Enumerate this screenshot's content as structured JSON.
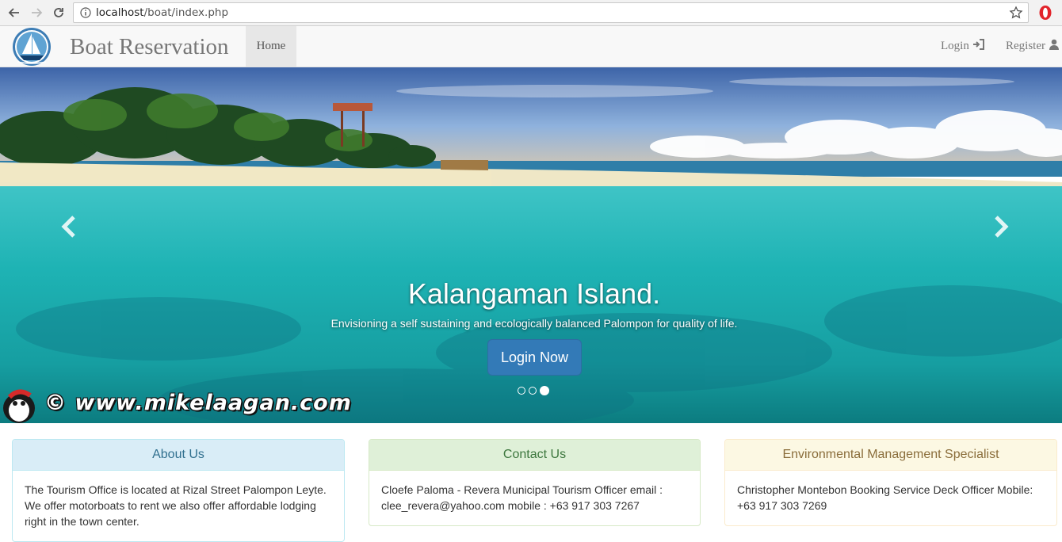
{
  "browser": {
    "url_host": "localhost",
    "url_path": "/boat/index.php"
  },
  "navbar": {
    "brand": "Boat Reservation",
    "home": "Home",
    "login": "Login",
    "register": "Register"
  },
  "carousel": {
    "title": "Kalangaman Island.",
    "subtitle": "Envisioning a self sustaining and ecologically balanced Palompon for quality of life.",
    "button": "Login Now",
    "watermark": "© www.mikelaagan.com",
    "active_slide": 3,
    "slide_count": 3
  },
  "panels": {
    "about": {
      "title": "About Us",
      "body": "The Tourism Office is located at Rizal Street Palompon Leyte. We offer motorboats to rent we also offer affordable lodging right in the town center."
    },
    "contact": {
      "title": "Contact Us",
      "body": "Cloefe Paloma - Revera Municipal Tourism Officer email : clee_revera@yahoo.com mobile : +63 917 303 7267"
    },
    "environment": {
      "title": "Environmental Management Specialist",
      "body": "Christopher Montebon Booking Service Deck Officer Mobile: +63 917 303 7269"
    }
  },
  "colors": {
    "primary": "#337ab7",
    "info_bg": "#d9edf7",
    "success_bg": "#dff0d8",
    "warning_bg": "#fcf8e3"
  }
}
